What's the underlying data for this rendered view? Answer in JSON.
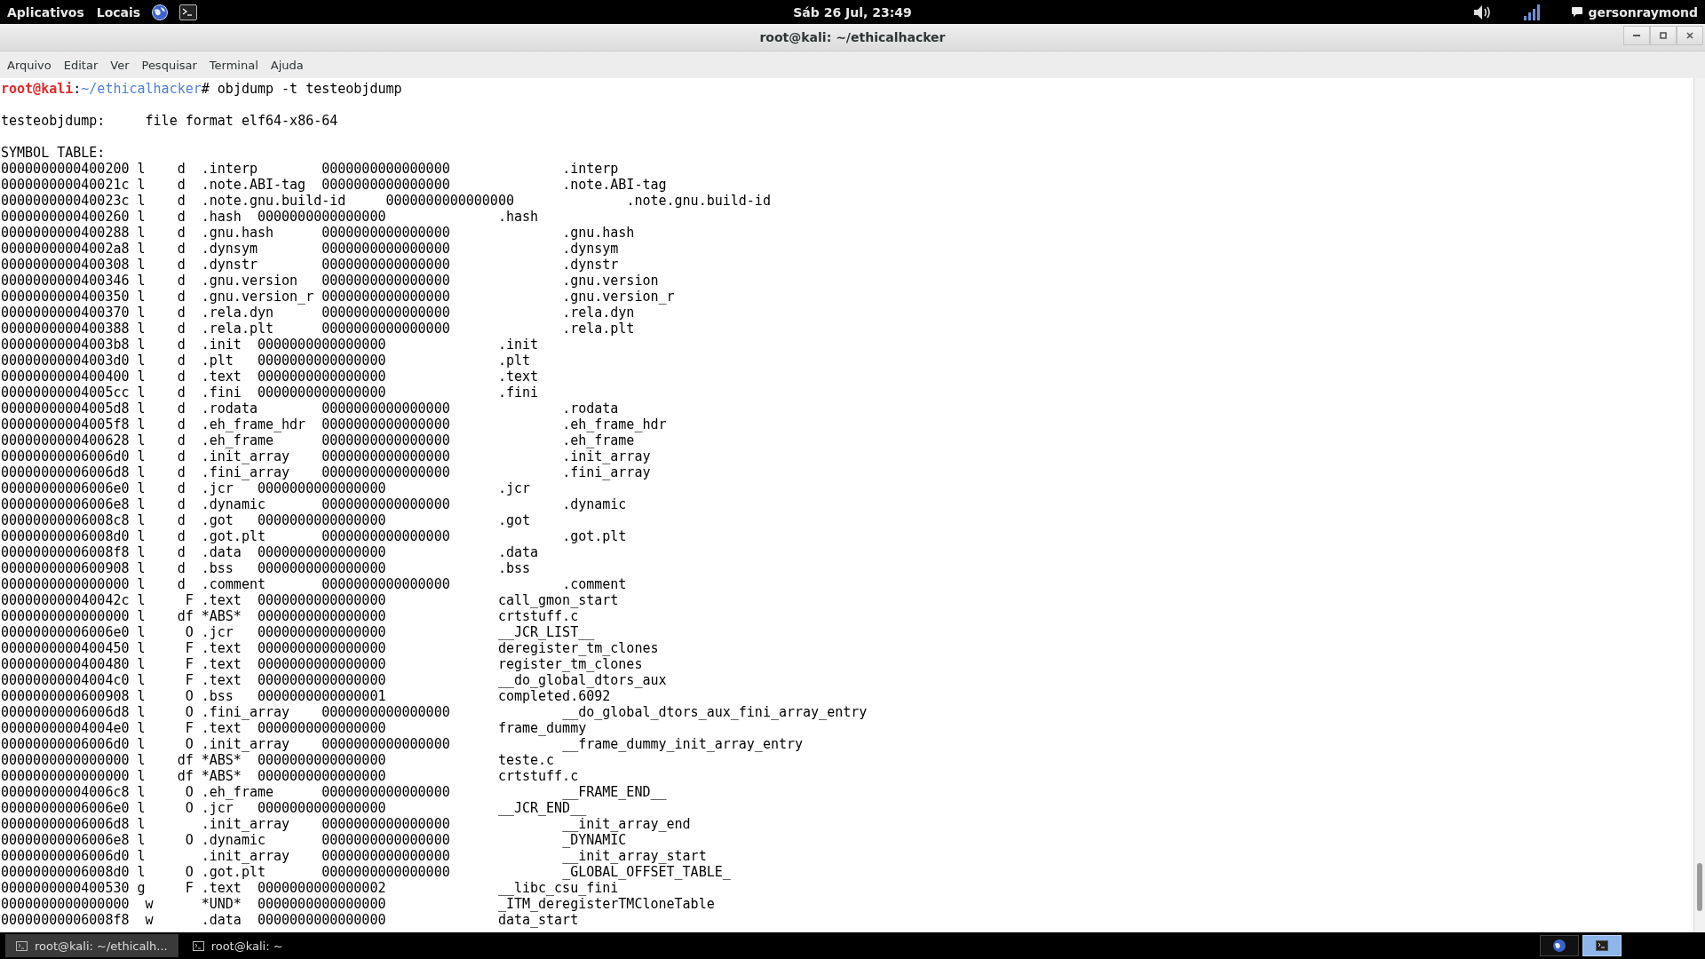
{
  "top_panel": {
    "menus": [
      "Aplicativos",
      "Locais"
    ],
    "clock": "Sáb 26 Jul, 23:49",
    "user": "gersonraymond"
  },
  "window": {
    "title": "root@kali: ~/ethicalhacker"
  },
  "menu_bar": [
    "Arquivo",
    "Editar",
    "Ver",
    "Pesquisar",
    "Terminal",
    "Ajuda"
  ],
  "terminal": {
    "prompt": {
      "user_host": "root@kali",
      "separator": ":",
      "path": "~/ethicalhacker",
      "command": "# objdump -t testeobjdump"
    },
    "file_line": "testeobjdump:     file format elf64-x86-64",
    "table_title": "SYMBOL TABLE:",
    "rows": [
      {
        "address": "0000000000400200",
        "flags": "l    d",
        "section": ".interp",
        "value": "0000000000000000",
        "name": ".interp"
      },
      {
        "address": "000000000040021c",
        "flags": "l    d",
        "section": ".note.ABI-tag",
        "value": "0000000000000000",
        "name": ".note.ABI-tag"
      },
      {
        "address": "000000000040023c",
        "flags": "l    d",
        "section": ".note.gnu.build-id",
        "value": "0000000000000000",
        "name": ".note.gnu.build-id"
      },
      {
        "address": "0000000000400260",
        "flags": "l    d",
        "section": ".hash",
        "value": "0000000000000000",
        "name": ".hash"
      },
      {
        "address": "0000000000400288",
        "flags": "l    d",
        "section": ".gnu.hash",
        "value": "0000000000000000",
        "name": ".gnu.hash"
      },
      {
        "address": "00000000004002a8",
        "flags": "l    d",
        "section": ".dynsym",
        "value": "0000000000000000",
        "name": ".dynsym"
      },
      {
        "address": "0000000000400308",
        "flags": "l    d",
        "section": ".dynstr",
        "value": "0000000000000000",
        "name": ".dynstr"
      },
      {
        "address": "0000000000400346",
        "flags": "l    d",
        "section": ".gnu.version",
        "value": "0000000000000000",
        "name": ".gnu.version"
      },
      {
        "address": "0000000000400350",
        "flags": "l    d",
        "section": ".gnu.version_r",
        "value": "0000000000000000",
        "name": ".gnu.version_r"
      },
      {
        "address": "0000000000400370",
        "flags": "l    d",
        "section": ".rela.dyn",
        "value": "0000000000000000",
        "name": ".rela.dyn"
      },
      {
        "address": "0000000000400388",
        "flags": "l    d",
        "section": ".rela.plt",
        "value": "0000000000000000",
        "name": ".rela.plt"
      },
      {
        "address": "00000000004003b8",
        "flags": "l    d",
        "section": ".init",
        "value": "0000000000000000",
        "name": ".init"
      },
      {
        "address": "00000000004003d0",
        "flags": "l    d",
        "section": ".plt",
        "value": "0000000000000000",
        "name": ".plt"
      },
      {
        "address": "0000000000400400",
        "flags": "l    d",
        "section": ".text",
        "value": "0000000000000000",
        "name": ".text"
      },
      {
        "address": "00000000004005cc",
        "flags": "l    d",
        "section": ".fini",
        "value": "0000000000000000",
        "name": ".fini"
      },
      {
        "address": "00000000004005d8",
        "flags": "l    d",
        "section": ".rodata",
        "value": "0000000000000000",
        "name": ".rodata"
      },
      {
        "address": "00000000004005f8",
        "flags": "l    d",
        "section": ".eh_frame_hdr",
        "value": "0000000000000000",
        "name": ".eh_frame_hdr"
      },
      {
        "address": "0000000000400628",
        "flags": "l    d",
        "section": ".eh_frame",
        "value": "0000000000000000",
        "name": ".eh_frame"
      },
      {
        "address": "00000000006006d0",
        "flags": "l    d",
        "section": ".init_array",
        "value": "0000000000000000",
        "name": ".init_array"
      },
      {
        "address": "00000000006006d8",
        "flags": "l    d",
        "section": ".fini_array",
        "value": "0000000000000000",
        "name": ".fini_array"
      },
      {
        "address": "00000000006006e0",
        "flags": "l    d",
        "section": ".jcr",
        "value": "0000000000000000",
        "name": ".jcr"
      },
      {
        "address": "00000000006006e8",
        "flags": "l    d",
        "section": ".dynamic",
        "value": "0000000000000000",
        "name": ".dynamic"
      },
      {
        "address": "00000000006008c8",
        "flags": "l    d",
        "section": ".got",
        "value": "0000000000000000",
        "name": ".got"
      },
      {
        "address": "00000000006008d0",
        "flags": "l    d",
        "section": ".got.plt",
        "value": "0000000000000000",
        "name": ".got.plt"
      },
      {
        "address": "00000000006008f8",
        "flags": "l    d",
        "section": ".data",
        "value": "0000000000000000",
        "name": ".data"
      },
      {
        "address": "0000000000600908",
        "flags": "l    d",
        "section": ".bss",
        "value": "0000000000000000",
        "name": ".bss"
      },
      {
        "address": "0000000000000000",
        "flags": "l    d",
        "section": ".comment",
        "value": "0000000000000000",
        "name": ".comment"
      },
      {
        "address": "000000000040042c",
        "flags": "l     F",
        "section": ".text",
        "value": "0000000000000000",
        "name": "call_gmon_start"
      },
      {
        "address": "0000000000000000",
        "flags": "l    df",
        "section": "*ABS*",
        "value": "0000000000000000",
        "name": "crtstuff.c"
      },
      {
        "address": "00000000006006e0",
        "flags": "l     O",
        "section": ".jcr",
        "value": "0000000000000000",
        "name": "__JCR_LIST__"
      },
      {
        "address": "0000000000400450",
        "flags": "l     F",
        "section": ".text",
        "value": "0000000000000000",
        "name": "deregister_tm_clones"
      },
      {
        "address": "0000000000400480",
        "flags": "l     F",
        "section": ".text",
        "value": "0000000000000000",
        "name": "register_tm_clones"
      },
      {
        "address": "00000000004004c0",
        "flags": "l     F",
        "section": ".text",
        "value": "0000000000000000",
        "name": "__do_global_dtors_aux"
      },
      {
        "address": "0000000000600908",
        "flags": "l     O",
        "section": ".bss",
        "value": "0000000000000001",
        "name": "completed.6092"
      },
      {
        "address": "00000000006006d8",
        "flags": "l     O",
        "section": ".fini_array",
        "value": "0000000000000000",
        "name": "__do_global_dtors_aux_fini_array_entry"
      },
      {
        "address": "00000000004004e0",
        "flags": "l     F",
        "section": ".text",
        "value": "0000000000000000",
        "name": "frame_dummy"
      },
      {
        "address": "00000000006006d0",
        "flags": "l     O",
        "section": ".init_array",
        "value": "0000000000000000",
        "name": "__frame_dummy_init_array_entry"
      },
      {
        "address": "0000000000000000",
        "flags": "l    df",
        "section": "*ABS*",
        "value": "0000000000000000",
        "name": "teste.c"
      },
      {
        "address": "0000000000000000",
        "flags": "l    df",
        "section": "*ABS*",
        "value": "0000000000000000",
        "name": "crtstuff.c"
      },
      {
        "address": "00000000004006c8",
        "flags": "l     O",
        "section": ".eh_frame",
        "value": "0000000000000000",
        "name": "__FRAME_END__"
      },
      {
        "address": "00000000006006e0",
        "flags": "l     O",
        "section": ".jcr",
        "value": "0000000000000000",
        "name": "__JCR_END__"
      },
      {
        "address": "00000000006006d8",
        "flags": "l",
        "section": ".init_array",
        "value": "0000000000000000",
        "name": "__init_array_end"
      },
      {
        "address": "00000000006006e8",
        "flags": "l     O",
        "section": ".dynamic",
        "value": "0000000000000000",
        "name": "_DYNAMIC"
      },
      {
        "address": "00000000006006d0",
        "flags": "l",
        "section": ".init_array",
        "value": "0000000000000000",
        "name": "__init_array_start"
      },
      {
        "address": "00000000006008d0",
        "flags": "l     O",
        "section": ".got.plt",
        "value": "0000000000000000",
        "name": "_GLOBAL_OFFSET_TABLE_"
      },
      {
        "address": "0000000000400530",
        "flags": "g     F",
        "section": ".text",
        "value": "0000000000000002",
        "name": "__libc_csu_fini"
      },
      {
        "address": "0000000000000000",
        "flags": " w",
        "section": "*UND*",
        "value": "0000000000000000",
        "name": "_ITM_deregisterTMCloneTable"
      },
      {
        "address": "00000000006008f8",
        "flags": " w",
        "section": ".data",
        "value": "0000000000000000",
        "name": "data_start"
      }
    ]
  },
  "taskbar": {
    "tasks": [
      {
        "label": "root@kali: ~/ethicalh...",
        "selected": true
      },
      {
        "label": "root@kali: ~",
        "selected": false
      }
    ],
    "workspaces": [
      {
        "kind": "globe",
        "selected": false
      },
      {
        "kind": "terminal",
        "selected": true
      }
    ]
  }
}
